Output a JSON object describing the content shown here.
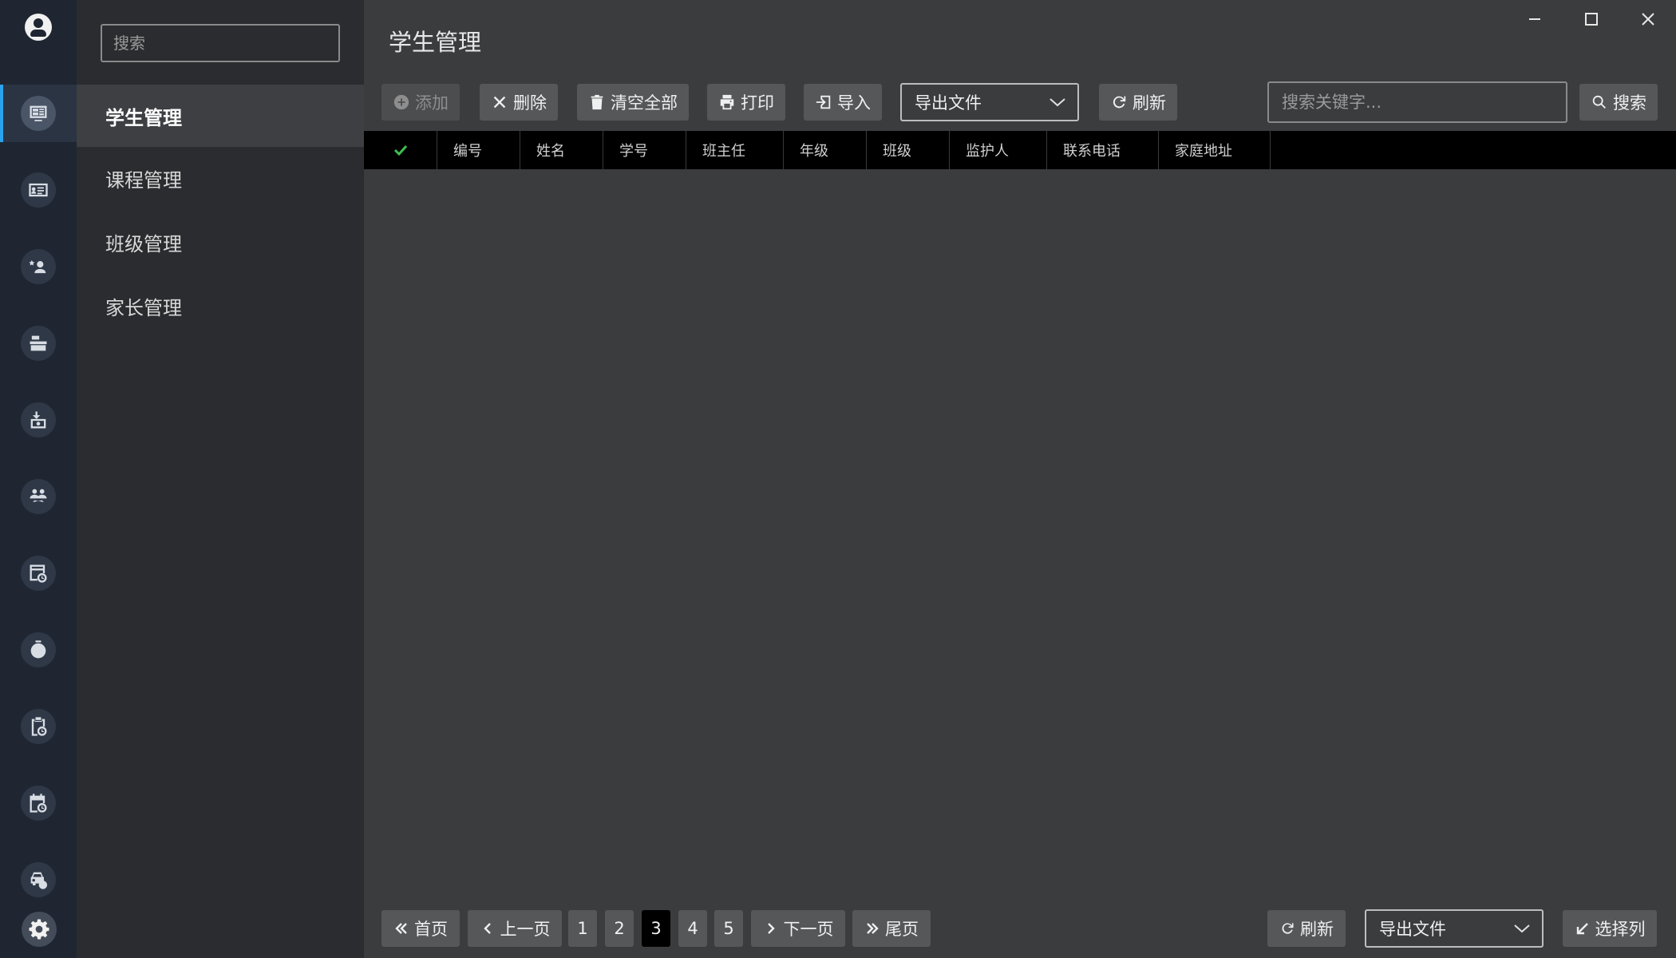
{
  "window": {
    "minimize_icon": "minimize-icon",
    "maximize_icon": "maximize-icon",
    "close_icon": "close-icon"
  },
  "rail": {
    "items": [
      {
        "icon": "dashboard-icon",
        "active": true
      },
      {
        "icon": "id-card-icon"
      },
      {
        "icon": "user-star-icon"
      },
      {
        "icon": "cash-register-icon"
      },
      {
        "icon": "money-transfer-icon"
      },
      {
        "icon": "users-exchange-icon"
      },
      {
        "icon": "table-clock-icon"
      },
      {
        "icon": "timer-icon"
      },
      {
        "icon": "clipboard-clock-icon"
      },
      {
        "icon": "calendar-clock-icon"
      },
      {
        "icon": "car-clock-icon"
      }
    ],
    "settings_icon": "gear-icon",
    "accent_color": "#2aa3ef"
  },
  "sidebar": {
    "search_placeholder": "搜索",
    "items": [
      {
        "label": "学生管理",
        "active": true
      },
      {
        "label": "课程管理"
      },
      {
        "label": "班级管理"
      },
      {
        "label": "家长管理"
      }
    ]
  },
  "main": {
    "title": "学生管理",
    "toolbar": {
      "add_label": "添加",
      "delete_label": "删除",
      "clear_all_label": "清空全部",
      "print_label": "打印",
      "import_label": "导入",
      "export_select_value": "导出文件",
      "refresh_label": "刷新",
      "search_placeholder": "搜索关键字...",
      "search_label": "搜索"
    },
    "table": {
      "columns": [
        "编号",
        "姓名",
        "学号",
        "班主任",
        "年级",
        "班级",
        "监护人",
        "联系电话",
        "家庭地址"
      ],
      "rows": []
    },
    "pagination": {
      "first_label": "首页",
      "prev_label": "上一页",
      "pages": [
        "1",
        "2",
        "3",
        "4",
        "5"
      ],
      "current_page": "3",
      "next_label": "下一页",
      "last_label": "尾页",
      "refresh_label": "刷新",
      "export_select_value": "导出文件",
      "select_columns_label": "选择列"
    }
  }
}
